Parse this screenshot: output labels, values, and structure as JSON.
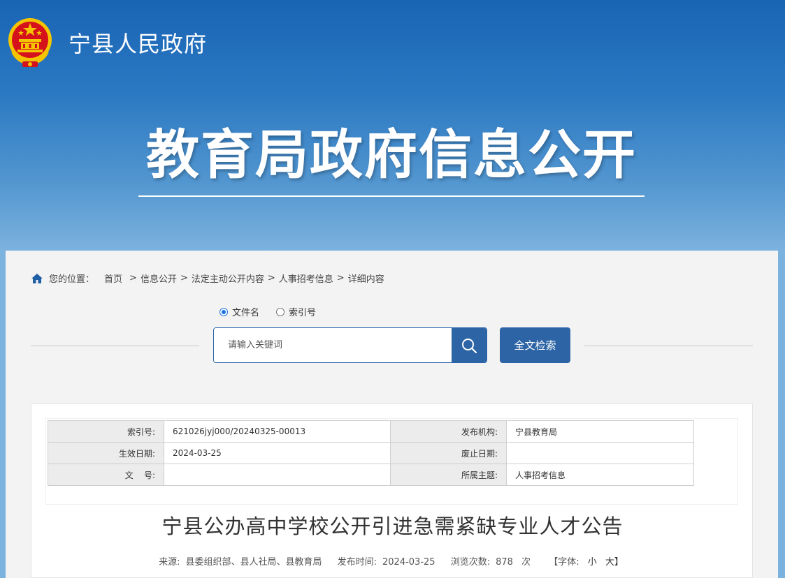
{
  "header": {
    "site_name": "宁县人民政府",
    "banner_title": "教育局政府信息公开"
  },
  "breadcrumb": {
    "label": "您的位置：",
    "items": [
      "首页",
      "信息公开",
      "法定主动公开内容",
      "人事招考信息",
      "详细内容"
    ],
    "separator": ">"
  },
  "search": {
    "options": [
      {
        "label": "文件名",
        "checked": true
      },
      {
        "label": "索引号",
        "checked": false
      }
    ],
    "placeholder": "请输入关键词",
    "fulltext_label": "全文检索"
  },
  "meta": {
    "index_label": "索引号:",
    "index_value": "621026jyj000/20240325-00013",
    "publisher_label": "发布机构:",
    "publisher_value": "宁县教育局",
    "effective_label": "生效日期:",
    "effective_value": "2024-03-25",
    "expire_label": "废止日期:",
    "expire_value": "",
    "docno_label": "文    号:",
    "docno_value": "",
    "topic_label": "所属主题:",
    "topic_value": "人事招考信息"
  },
  "article": {
    "title": "宁县公办高中学校公开引进急需紧缺专业人才公告",
    "source_label": "来源:",
    "source_value": "县委组织部、县人社局、县教育局",
    "publish_label": "发布时间:",
    "publish_value": "2024-03-25",
    "views_label": "浏览次数:",
    "views_value": "878",
    "views_unit": "次",
    "font_label": "【字体:",
    "font_small": "小",
    "font_large": "大】"
  },
  "colors": {
    "primary_button": "#2d64a6",
    "header_top": "#1a64b4",
    "emblem_red": "#d5121b",
    "emblem_gold": "#f5c400"
  }
}
